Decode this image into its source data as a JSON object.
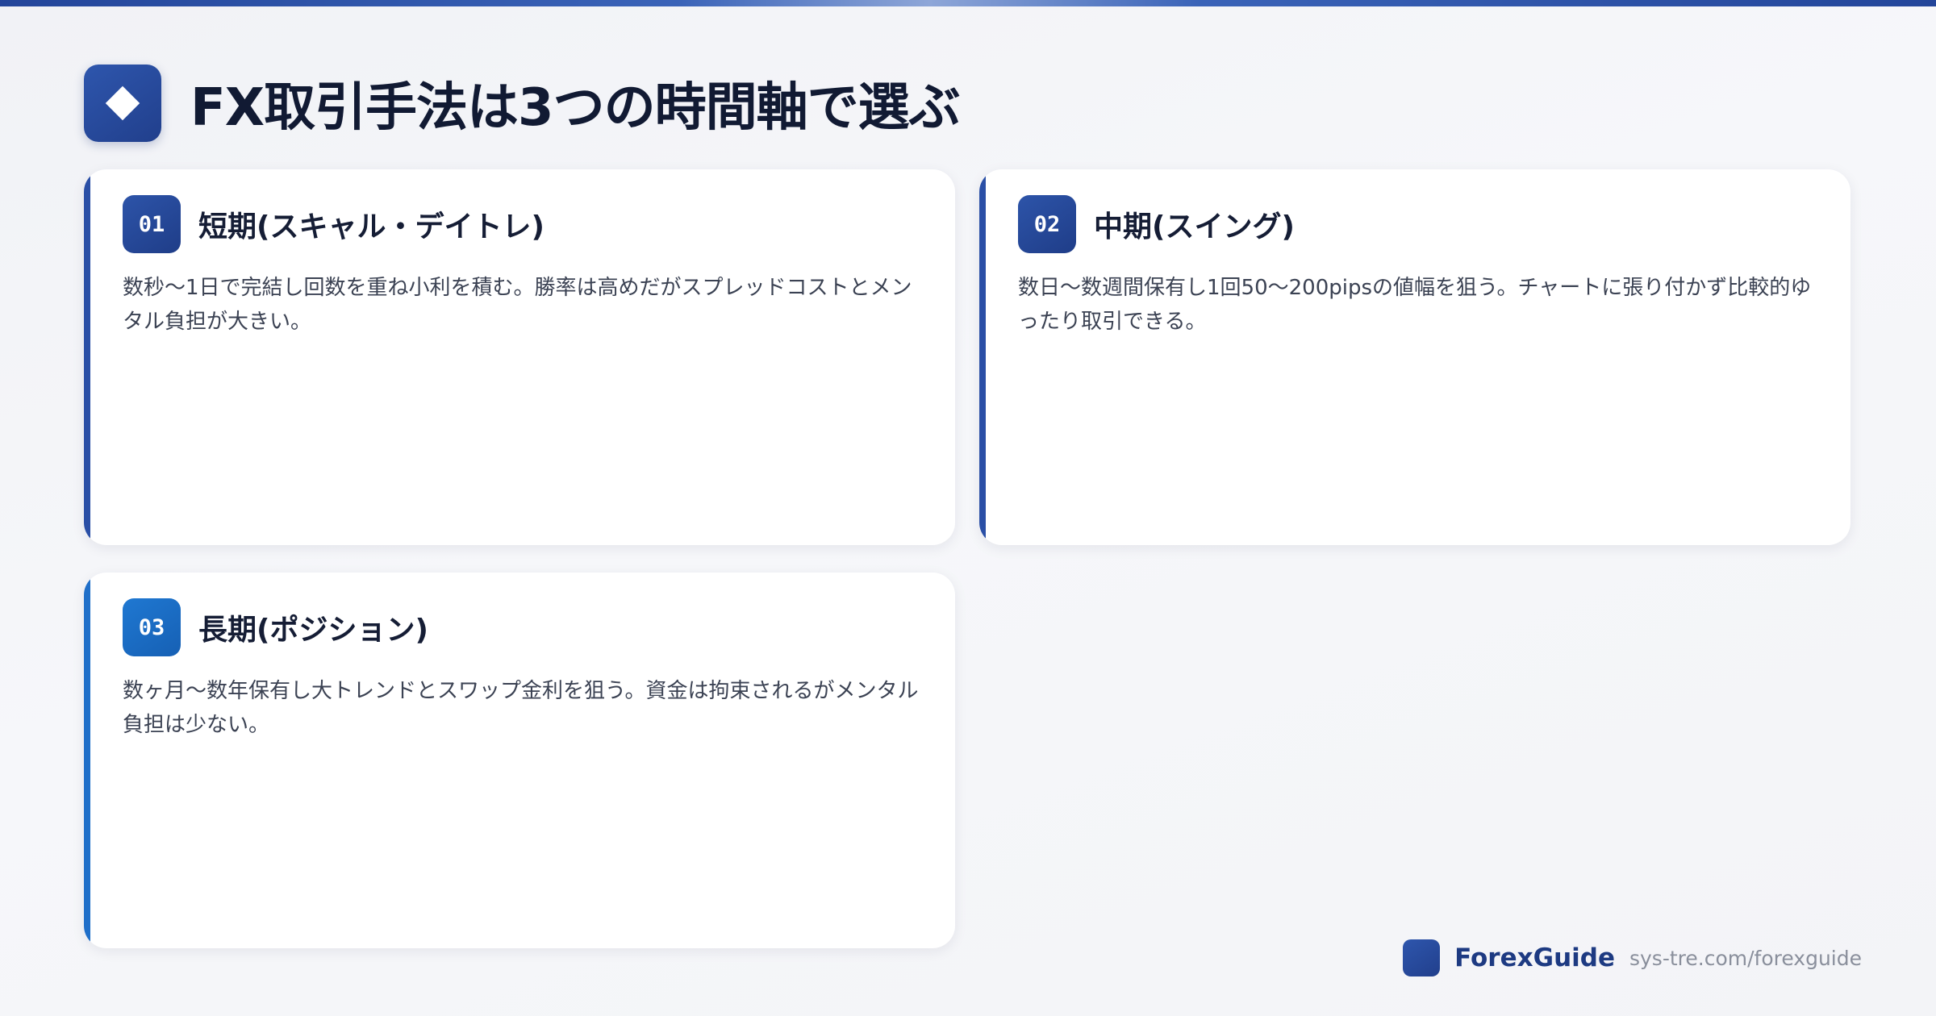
{
  "header": {
    "icon": "diamond-icon",
    "title": "FX取引手法は3つの時間軸で選ぶ"
  },
  "cards": [
    {
      "number": "01",
      "title": "短期(スキャル・デイトレ)",
      "description": "数秒〜1日で完結し回数を重ね小利を積む。勝率は高めだがスプレッドコストとメンタル負担が大きい。",
      "accent_color": "#2a4fa6"
    },
    {
      "number": "02",
      "title": "中期(スイング)",
      "description": "数日〜数週間保有し1回50〜200pipsの値幅を狙う。チャートに張り付かず比較的ゆったり取引できる。",
      "accent_color": "#2a4fa6"
    },
    {
      "number": "03",
      "title": "長期(ポジション)",
      "description": "数ヶ月〜数年保有し大トレンドとスワップ金利を狙う。資金は拘束されるがメンタル負担は少ない。",
      "accent_color": "#1f6fc9"
    }
  ],
  "footer": {
    "brand": "ForexGuide",
    "url": "sys-tre.com/forexguide"
  },
  "colors": {
    "primary": "#2a4fa6",
    "accent_blue": "#1f6fc9",
    "title_text": "#111a33",
    "body_text": "#3b4253"
  }
}
